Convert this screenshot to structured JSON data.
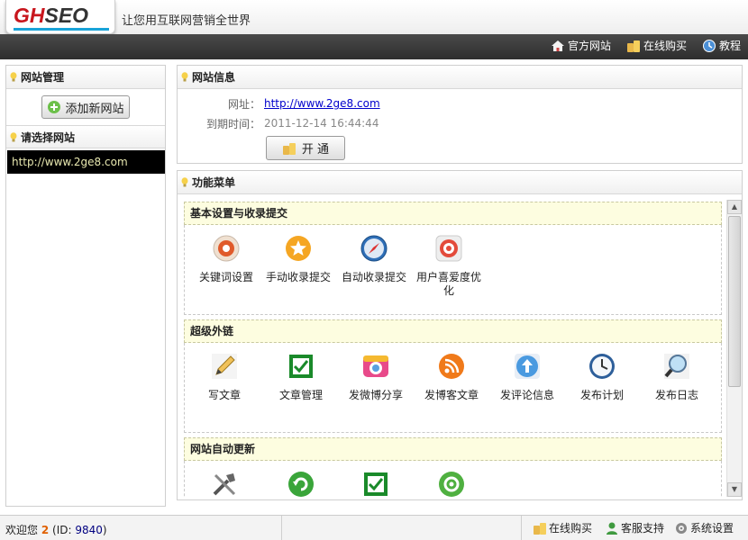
{
  "header": {
    "logo_text_hl": "GH",
    "logo_text_rest": "SEO",
    "slogan": "让您用互联网营销全世界",
    "links": {
      "official_site": "官方网站",
      "buy_online": "在线购买",
      "tutorial": "教程"
    }
  },
  "sidebar": {
    "site_mgmt_title": "网站管理",
    "add_site_button": "添加新网站",
    "select_site_title": "请选择网站",
    "selected_site": "http://www.2ge8.com"
  },
  "site_info": {
    "title": "网站信息",
    "url_label": "网址：",
    "url_value": "http://www.2ge8.com",
    "expiry_label": "到期时间：",
    "expiry_value": "2011-12-14 16:44:44",
    "open_button": "开 通"
  },
  "menu": {
    "title": "功能菜单",
    "sections": [
      {
        "title": "基本设置与收录提交",
        "items": [
          "关键词设置",
          "手动收录提交",
          "自动收录提交",
          "用户喜爱度优化"
        ]
      },
      {
        "title": "超级外链",
        "items": [
          "写文章",
          "文章管理",
          "发微博分享",
          "发博客文章",
          "发评论信息",
          "发布计划",
          "发布日志"
        ]
      },
      {
        "title": "网站自动更新",
        "items": [
          "",
          "",
          "",
          ""
        ]
      }
    ]
  },
  "footer": {
    "welcome_prefix": "欢迎您",
    "user_count": "2",
    "id_prefix": "(ID:",
    "id_value": "9840",
    "id_suffix": ")",
    "buy_online": "在线购买",
    "support": "客服支持",
    "settings": "系统设置"
  },
  "colors": {
    "accent": "#19a3d8",
    "brand_red": "#c8161d",
    "section_bg": "#fdfde0",
    "dark_bar": "#3a3a3a"
  }
}
